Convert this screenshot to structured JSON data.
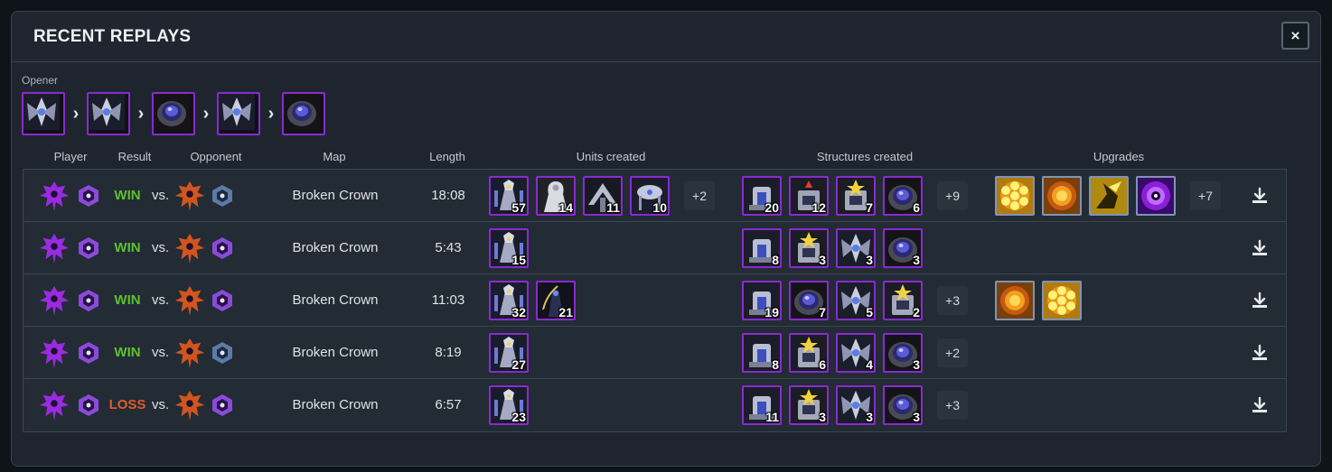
{
  "panel": {
    "title": "RECENT REPLAYS",
    "close_label": "×"
  },
  "opener": {
    "label": "Opener",
    "items": [
      "probe-icon",
      "probe-icon",
      "pylon-icon",
      "probe-icon",
      "pylon-icon"
    ],
    "separator": "›"
  },
  "columns": {
    "player": "Player",
    "result": "Result",
    "opponent": "Opponent",
    "map": "Map",
    "length": "Length",
    "units": "Units created",
    "structures": "Structures created",
    "upgrades": "Upgrades"
  },
  "vs_label": "vs.",
  "colors": {
    "win": "#5cc22e",
    "loss": "#e25a2c",
    "unit_border": "#8a2ad1",
    "upgrade_border": "#7d95b4"
  },
  "rows": [
    {
      "result": "WIN",
      "result_class": "win",
      "map": "Broken Crown",
      "length": "18:08",
      "player_rank": "rank-purple",
      "opponent_rank": "rank-silver",
      "units": [
        {
          "icon": "zealot-icon",
          "count": "57"
        },
        {
          "icon": "sentry-icon",
          "count": "14"
        },
        {
          "icon": "adept-icon",
          "count": "11"
        },
        {
          "icon": "stalker-icon",
          "count": "10"
        }
      ],
      "units_more": "+2",
      "structures": [
        {
          "icon": "gateway-icon",
          "count": "20"
        },
        {
          "icon": "forge-icon",
          "count": "12"
        },
        {
          "icon": "cybercore-icon",
          "count": "7"
        },
        {
          "icon": "pylon-icon",
          "count": "6"
        }
      ],
      "structures_more": "+9",
      "upgrades": [
        "shields-upgrade-icon",
        "weapons-upgrade-icon",
        "charge-upgrade-icon",
        "warpgate-upgrade-icon"
      ],
      "upgrades_more": "+7"
    },
    {
      "result": "WIN",
      "result_class": "win",
      "map": "Broken Crown",
      "length": "5:43",
      "player_rank": "rank-purple",
      "opponent_rank": "rank-purple",
      "units": [
        {
          "icon": "zealot-icon",
          "count": "15"
        }
      ],
      "units_more": "",
      "structures": [
        {
          "icon": "gateway-icon",
          "count": "8"
        },
        {
          "icon": "cybercore-icon",
          "count": "3"
        },
        {
          "icon": "probe-icon",
          "count": "3"
        },
        {
          "icon": "pylon-icon",
          "count": "3"
        }
      ],
      "structures_more": "",
      "upgrades": [],
      "upgrades_more": ""
    },
    {
      "result": "WIN",
      "result_class": "win",
      "map": "Broken Crown",
      "length": "11:03",
      "player_rank": "rank-purple",
      "opponent_rank": "rank-purple",
      "units": [
        {
          "icon": "zealot-icon",
          "count": "32"
        },
        {
          "icon": "darktemplar-icon",
          "count": "21"
        }
      ],
      "units_more": "",
      "structures": [
        {
          "icon": "gateway-icon",
          "count": "19"
        },
        {
          "icon": "pylon-icon",
          "count": "7"
        },
        {
          "icon": "probe-icon",
          "count": "5"
        },
        {
          "icon": "cybercore-icon",
          "count": "2"
        }
      ],
      "structures_more": "+3",
      "upgrades": [
        "weapons-upgrade-icon",
        "shields-upgrade-icon"
      ],
      "upgrades_more": ""
    },
    {
      "result": "WIN",
      "result_class": "win",
      "map": "Broken Crown",
      "length": "8:19",
      "player_rank": "rank-purple",
      "opponent_rank": "rank-silver",
      "units": [
        {
          "icon": "zealot-icon",
          "count": "27"
        }
      ],
      "units_more": "",
      "structures": [
        {
          "icon": "gateway-icon",
          "count": "8"
        },
        {
          "icon": "cybercore-icon",
          "count": "6"
        },
        {
          "icon": "probe-icon",
          "count": "4"
        },
        {
          "icon": "pylon-icon",
          "count": "3"
        }
      ],
      "structures_more": "+2",
      "upgrades": [],
      "upgrades_more": ""
    },
    {
      "result": "LOSS",
      "result_class": "loss",
      "map": "Broken Crown",
      "length": "6:57",
      "player_rank": "rank-purple",
      "opponent_rank": "rank-purple",
      "units": [
        {
          "icon": "zealot-icon",
          "count": "23"
        }
      ],
      "units_more": "",
      "structures": [
        {
          "icon": "gateway-icon",
          "count": "11"
        },
        {
          "icon": "cybercore-icon",
          "count": "3"
        },
        {
          "icon": "probe-icon",
          "count": "3"
        },
        {
          "icon": "pylon-icon",
          "count": "3"
        }
      ],
      "structures_more": "+3",
      "upgrades": [],
      "upgrades_more": ""
    }
  ]
}
